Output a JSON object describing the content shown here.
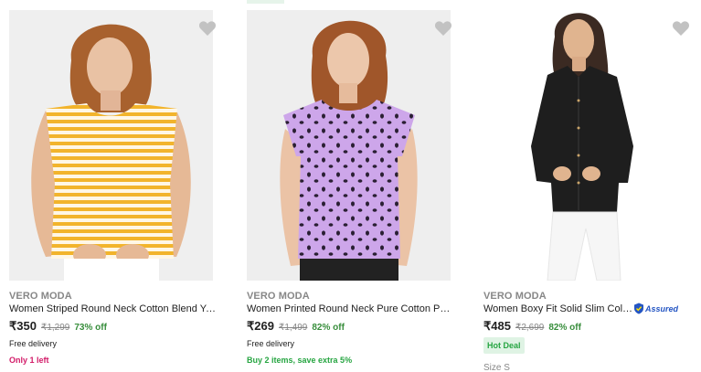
{
  "products": [
    {
      "brand": "VERO MODA",
      "title": "Women Striped Round Neck Cotton Blend Yellow, White T-Shirt",
      "price": "₹350",
      "mrp": "₹1,299",
      "off": "73% off",
      "delivery": "Free delivery",
      "note": "Only 1 left",
      "image_icon": "woman-yellow-striped-top-photo"
    },
    {
      "brand": "VERO MODA",
      "title": "Women Printed Round Neck Pure Cotton Purple T-Shirt",
      "price": "₹269",
      "mrp": "₹1,499",
      "off": "82% off",
      "delivery": "Free delivery",
      "note": "Buy 2 items, save extra 5%",
      "image_icon": "woman-purple-printed-tee-photo"
    },
    {
      "brand": "VERO MODA",
      "title": "Women Boxy Fit Solid Slim Collar Casual Shirt",
      "price": "₹485",
      "mrp": "₹2,699",
      "off": "82% off",
      "badge": "Hot Deal",
      "size": "Size S",
      "assured": "Assured",
      "image_icon": "woman-black-shirt-photo"
    }
  ],
  "colors": {
    "brand_gray": "#878787",
    "price_green": "#388e3c",
    "stock_red": "#d21b68",
    "offer_green": "#26a541",
    "wishlist_gray": "#c2c2c2"
  }
}
